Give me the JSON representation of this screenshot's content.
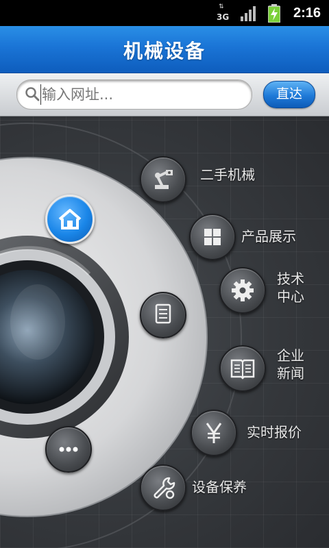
{
  "status_bar": {
    "network": "3G",
    "time": "2:16"
  },
  "header": {
    "title": "机械设备"
  },
  "search": {
    "placeholder": "输入网址...",
    "value": "",
    "go_label": "直达"
  },
  "menu": [
    {
      "id": "used-machinery",
      "label": "二手机械",
      "icon": "robot-arm-icon"
    },
    {
      "id": "product-showcase",
      "label": "产品展示",
      "icon": "grid-icon"
    },
    {
      "id": "tech-center",
      "label_line1": "技术",
      "label_line2": "中心",
      "icon": "gear-icon"
    },
    {
      "id": "company-news",
      "label_line1": "企业",
      "label_line2": "新闻",
      "icon": "book-icon"
    },
    {
      "id": "price-quotes",
      "label": "实时报价",
      "icon": "yen-icon"
    },
    {
      "id": "maintenance",
      "label": "设备保养",
      "icon": "wrench-icon"
    }
  ],
  "dial": {
    "home_icon": "home-icon",
    "list_icon": "document-icon",
    "more_icon": "more-icon",
    "accent_color": "#1a86e8"
  }
}
